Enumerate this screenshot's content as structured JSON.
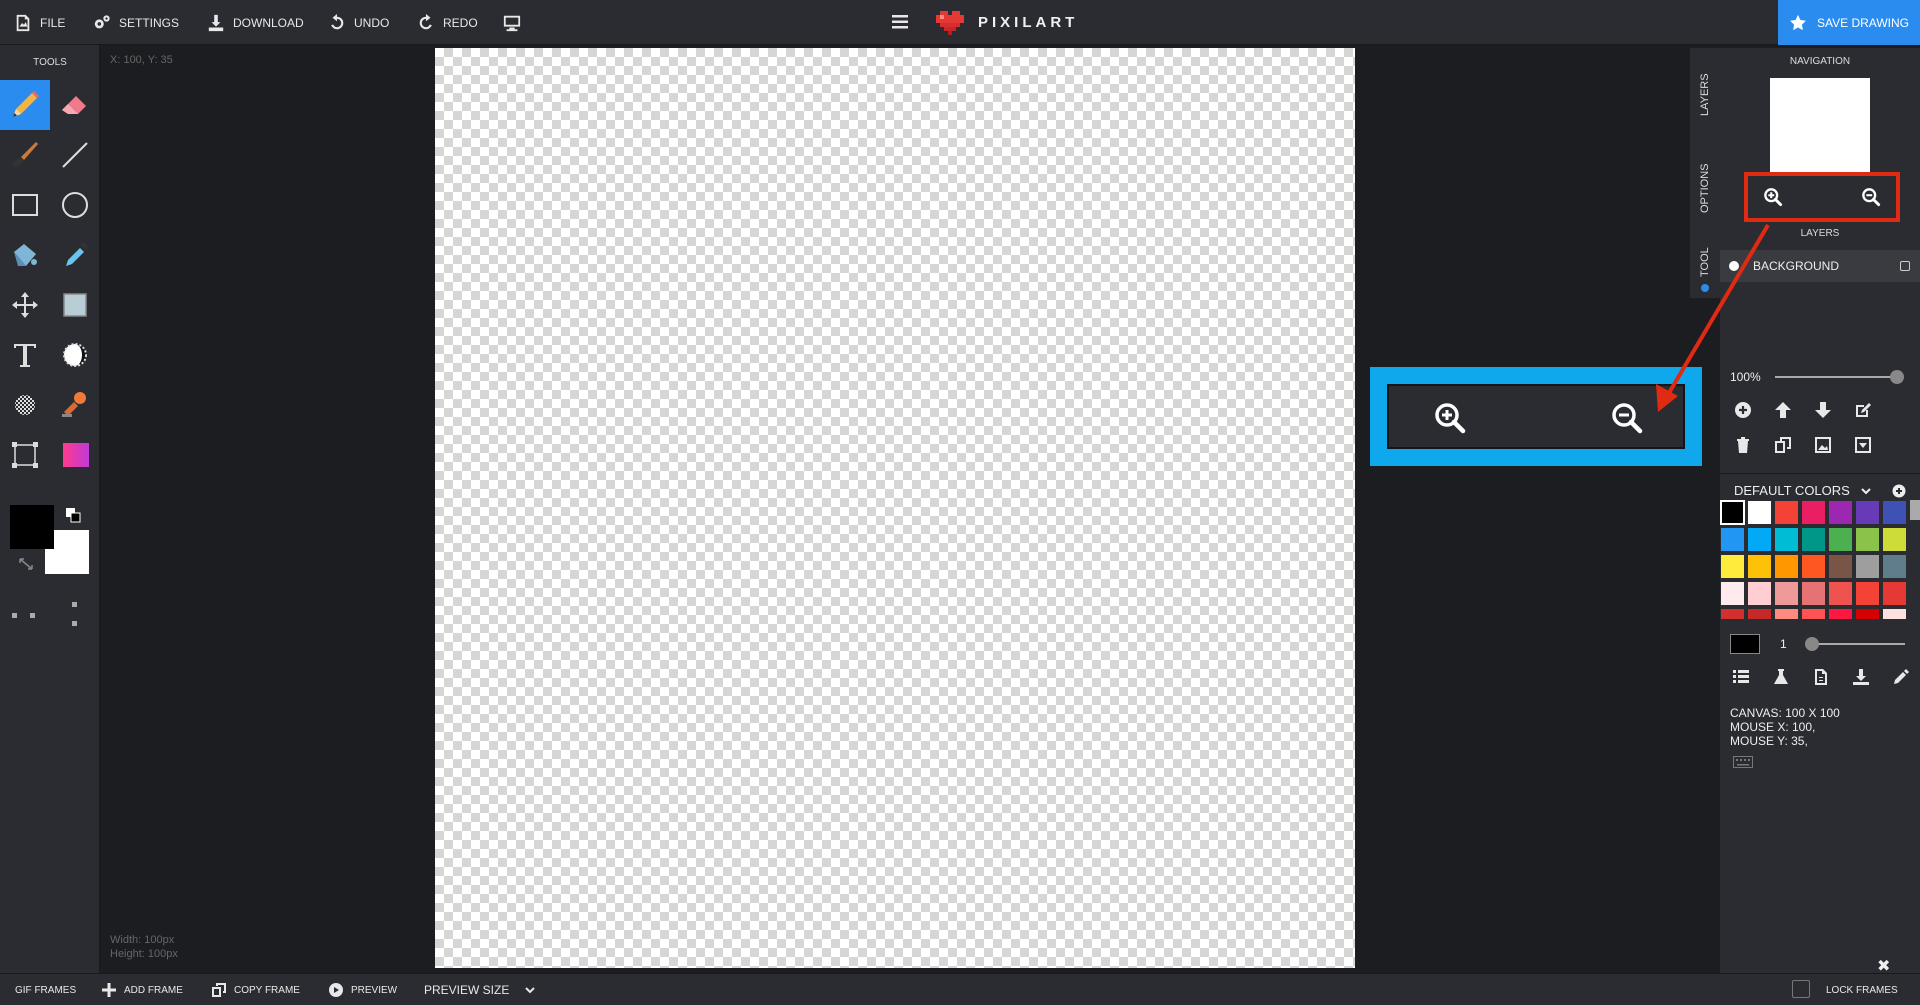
{
  "topbar": {
    "file": "FILE",
    "settings": "SETTINGS",
    "download": "DOWNLOAD",
    "undo": "UNDO",
    "redo": "REDO",
    "logo": "PIXILART",
    "save": "SAVE DRAWING"
  },
  "tools": {
    "title": "TOOLS",
    "items": [
      "pencil-icon",
      "eraser-icon",
      "brush-icon",
      "line-icon",
      "rectangle-icon",
      "circle-icon",
      "bucket-icon",
      "eyedropper-icon",
      "move-icon",
      "fill-rect-icon",
      "text-icon",
      "lighten-icon",
      "dither-icon",
      "stamp-icon",
      "select-icon",
      "gradient-icon"
    ],
    "active": "pencil-icon"
  },
  "status": {
    "coords": "X: 100, Y: 35",
    "width": "Width: 100px",
    "height": "Height: 100px"
  },
  "side_tabs": [
    "LAYERS",
    "OPTIONS",
    "TOOL"
  ],
  "panel": {
    "navigation_title": "NAVIGATION",
    "layers_title": "LAYERS",
    "layer_name": "BACKGROUND",
    "zoom": "100%",
    "zoom_level": 1.0,
    "colors_title": "DEFAULT COLORS",
    "brush_size": "1",
    "canvas_info": "CANVAS: 100 X 100",
    "mouse_x": "MOUSE X: 100,",
    "mouse_y": "MOUSE Y: 35,"
  },
  "palette": [
    "#000000",
    "#ffffff",
    "#f44336",
    "#e91e63",
    "#9c27b0",
    "#673ab7",
    "#3f51b5",
    "#2196f3",
    "#03a9f4",
    "#00bcd4",
    "#009688",
    "#4caf50",
    "#8bc34a",
    "#cddc39",
    "#ffeb3b",
    "#ffc107",
    "#ff9800",
    "#ff5722",
    "#795548",
    "#9e9e9e",
    "#607d8b",
    "#ffebee",
    "#ffcdd2",
    "#ef9a9a",
    "#e57373",
    "#ef5350",
    "#f44336",
    "#e53935",
    "#d32f2f",
    "#c62828",
    "#ff8a80",
    "#ff5252",
    "#ff1744",
    "#d50000",
    "#ffe0e0"
  ],
  "bottombar": {
    "gif_frames": "GIF FRAMES",
    "add_frame": "ADD FRAME",
    "copy_frame": "COPY FRAME",
    "preview": "PREVIEW",
    "preview_size": "PREVIEW SIZE",
    "lock_frames": "LOCK FRAMES"
  },
  "colors": {
    "accent": "#2b8cf0",
    "callout": "#10a8ec",
    "highlight": "#e02a12"
  }
}
